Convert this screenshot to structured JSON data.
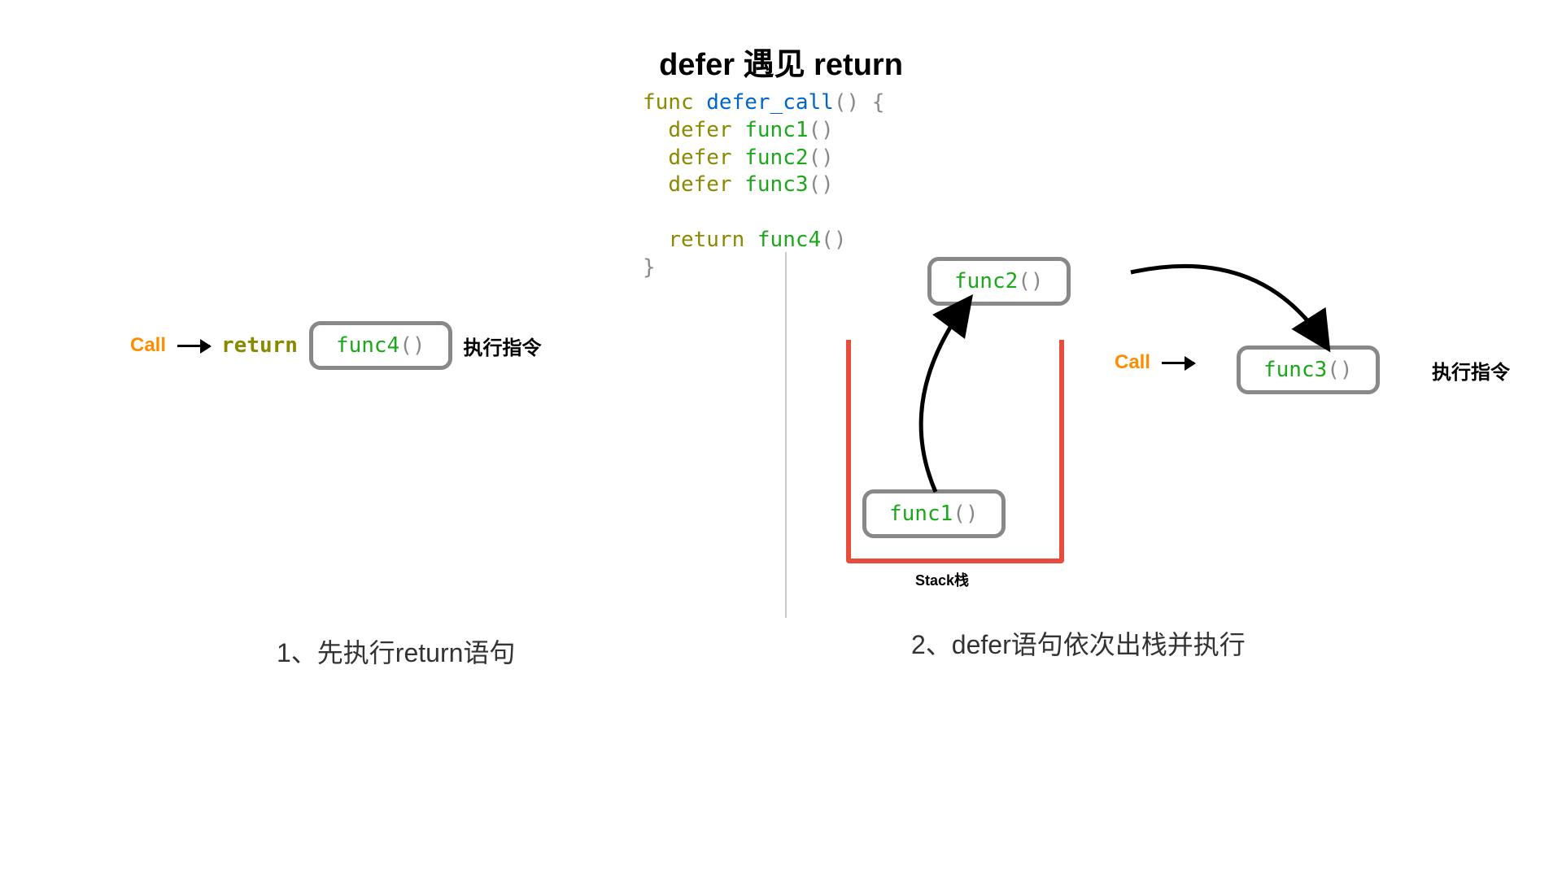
{
  "title": "defer 遇见 return",
  "code": {
    "func_kw": "func",
    "func_name": "defer_call",
    "open": "() {",
    "defer_kw": "defer",
    "func1": "func1",
    "func2": "func2",
    "func3": "func3",
    "return_kw": "return",
    "func4": "func4",
    "close": "}"
  },
  "labels": {
    "call": "Call",
    "return": "return",
    "exec": "执行指令",
    "stack": "Stack栈"
  },
  "boxes": {
    "func1": "func1",
    "func2": "func2",
    "func3": "func3",
    "func4": "func4",
    "parens": "()"
  },
  "captions": {
    "left": "1、先执行return语句",
    "right": "2、defer语句依次出栈并执行"
  }
}
